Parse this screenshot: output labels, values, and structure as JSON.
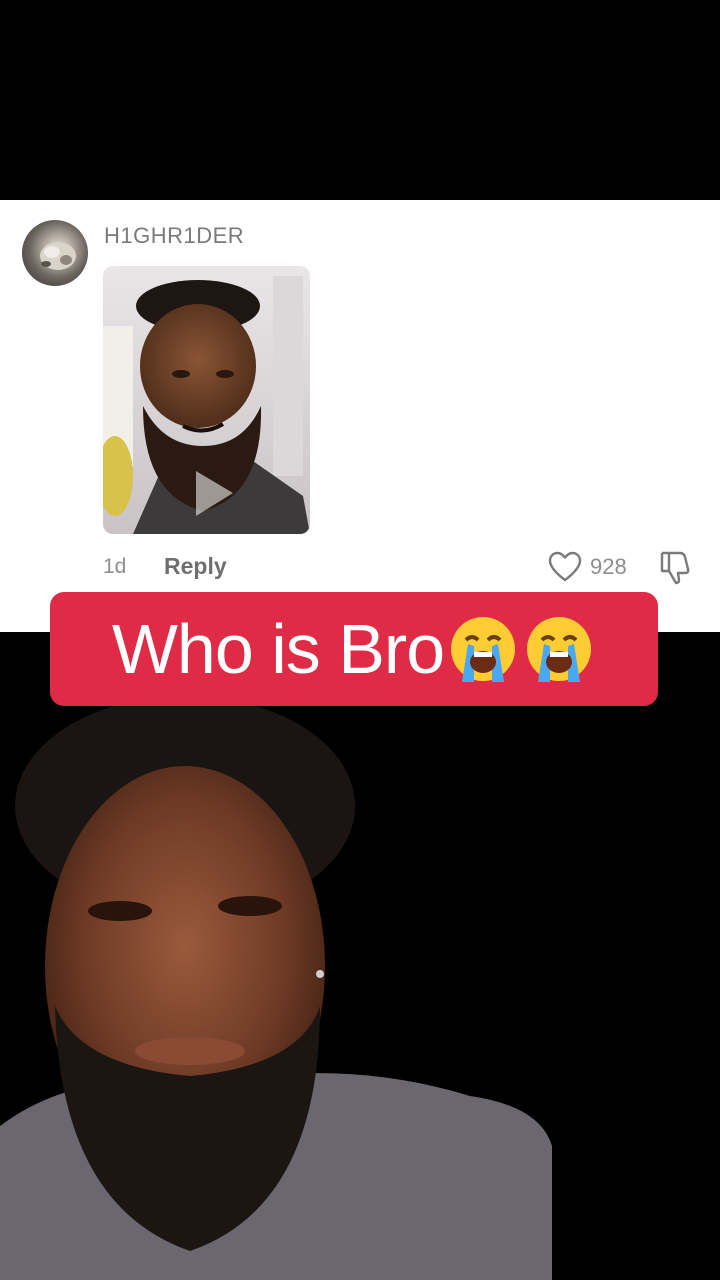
{
  "comment": {
    "username": "H1GHR1DER",
    "time": "1d",
    "reply_label": "Reply",
    "like_count": "928"
  },
  "caption": {
    "text": "Who is Bro",
    "emojis": [
      "crying-face",
      "crying-face"
    ]
  },
  "colors": {
    "banner": "#df2b45",
    "card_bg": "#ffffff",
    "muted_text": "#8e8e8e"
  }
}
